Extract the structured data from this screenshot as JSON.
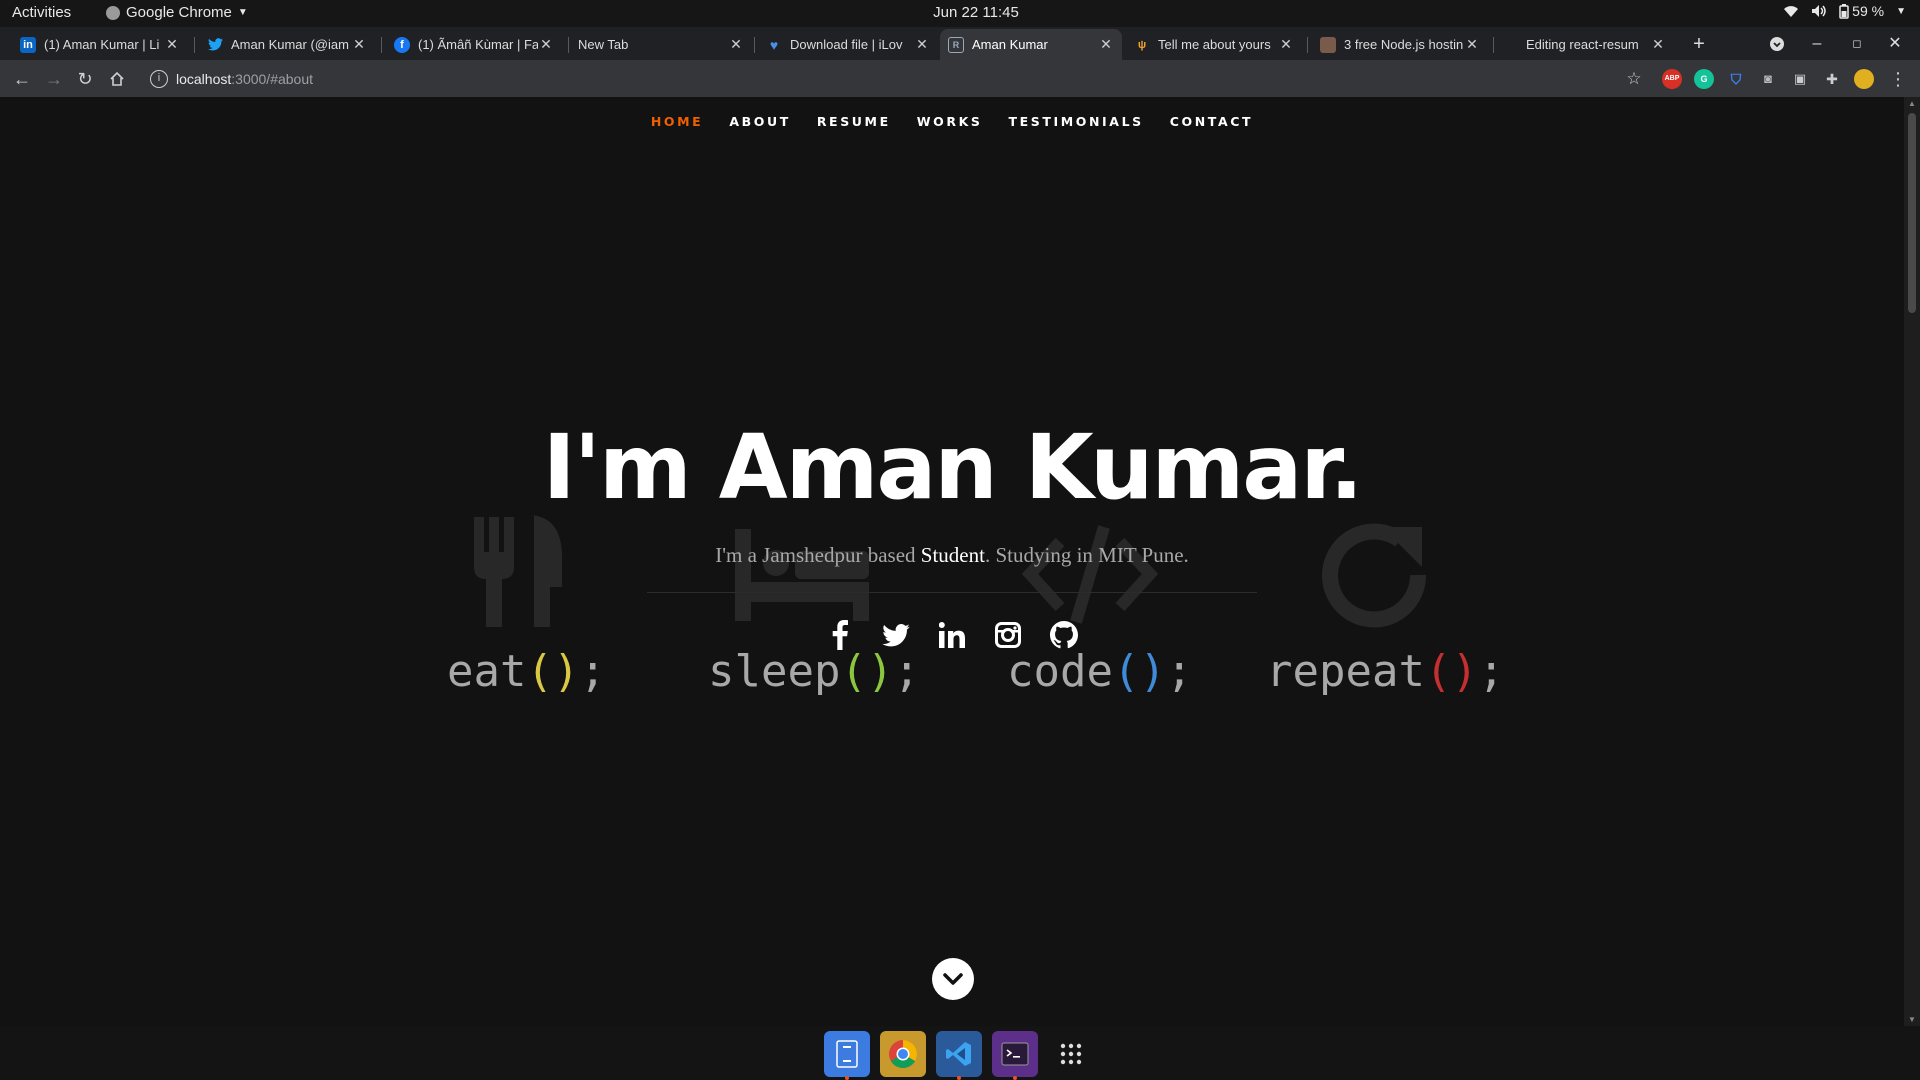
{
  "system_bar": {
    "activities": "Activities",
    "app_name": "Google Chrome",
    "datetime": "Jun 22  11:45",
    "battery": "59 %"
  },
  "tabs": [
    {
      "title": "(1) Aman Kumar | Li",
      "icon": "linkedin-icon"
    },
    {
      "title": "Aman Kumar (@iam",
      "icon": "twitter-icon"
    },
    {
      "title": "(1) Ãmâñ Kùmar | Fa",
      "icon": "facebook-icon"
    },
    {
      "title": "New Tab",
      "icon": ""
    },
    {
      "title": "Download file | iLov",
      "icon": "ilovepdf-icon"
    },
    {
      "title": "Aman Kumar",
      "icon": "react-page-icon"
    },
    {
      "title": "Tell me about yours",
      "icon": "sourcerer-icon"
    },
    {
      "title": "3 free Node.js hostin",
      "icon": "avatar-icon"
    },
    {
      "title": "Editing react-resum",
      "icon": ""
    }
  ],
  "address_bar": {
    "host": "localhost",
    "path": ":3000/#about"
  },
  "site": {
    "nav": [
      "HOME",
      "ABOUT",
      "RESUME",
      "WORKS",
      "TESTIMONIALS",
      "CONTACT"
    ],
    "title": "I'm Aman Kumar.",
    "subtitle_pre": "I'm a Jamshedpur based ",
    "subtitle_role": "Student",
    "subtitle_post": ". Studying in MIT Pune.",
    "background_words": [
      {
        "word": "eat",
        "paren_color": "#d9c843"
      },
      {
        "word": "sleep",
        "paren_color": "#8cc63e"
      },
      {
        "word": "code",
        "paren_color": "#3f8bd8"
      },
      {
        "word": "repeat",
        "paren_color": "#c62f2f"
      }
    ],
    "background_icons": [
      "fork-knife-icon",
      "bed-icon",
      "code-icon",
      "repeat-icon"
    ],
    "socials": [
      "facebook-icon",
      "twitter-icon",
      "linkedin-icon",
      "instagram-icon",
      "github-icon"
    ],
    "accent_color": "#F06000"
  },
  "dock": [
    "files-icon",
    "chrome-icon",
    "vscode-icon",
    "terminal-icon",
    "app-grid-icon"
  ]
}
